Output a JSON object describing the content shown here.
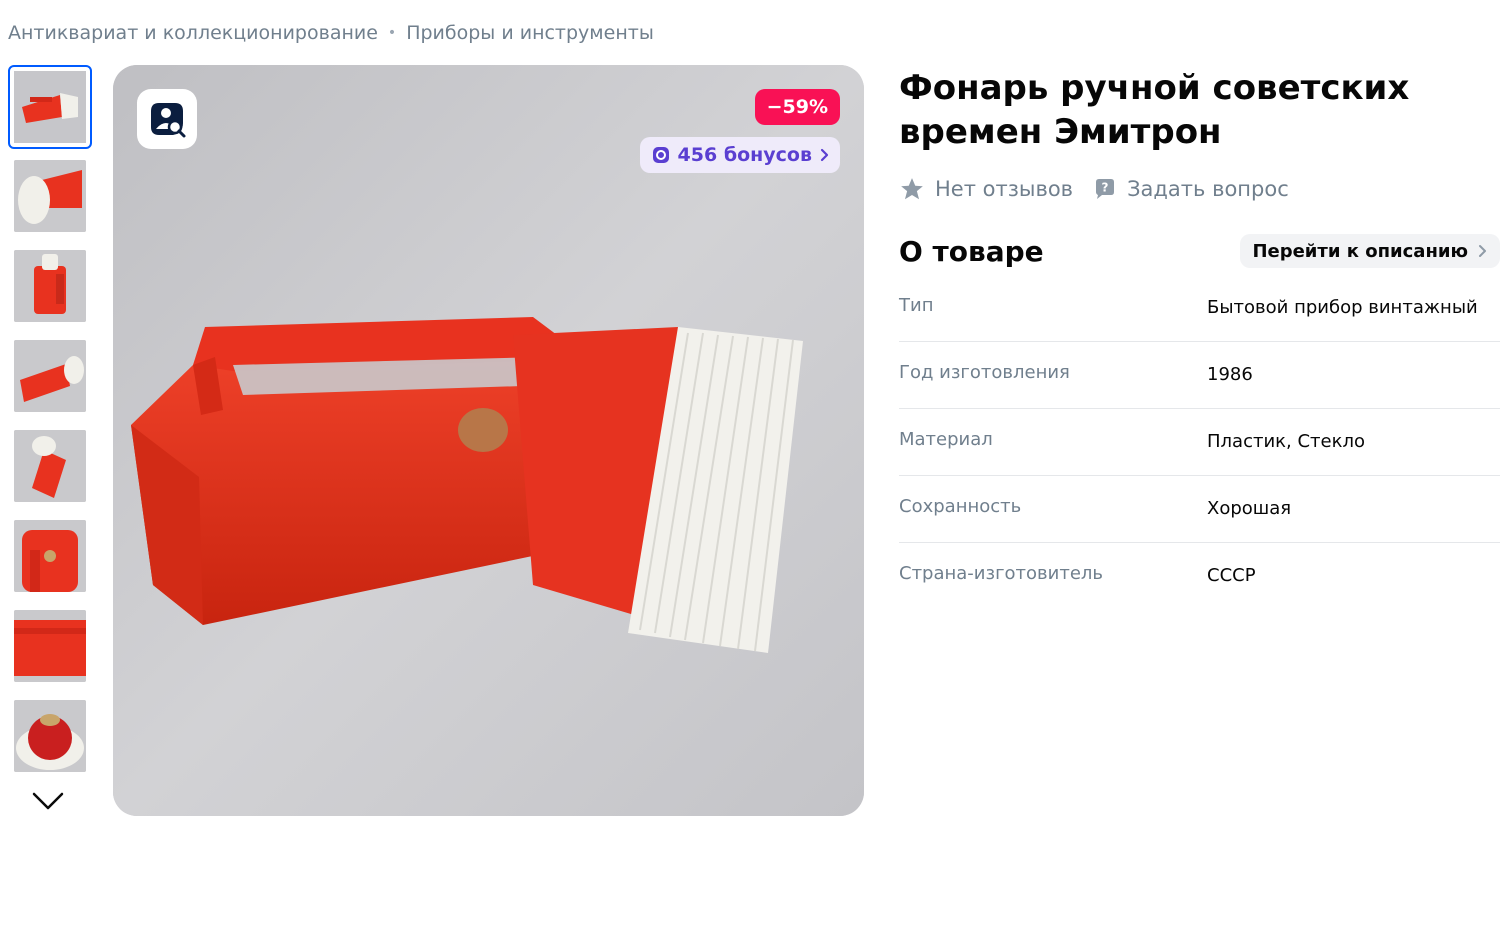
{
  "breadcrumbs": [
    "Антиквариат и коллекционирование",
    "Приборы и инструменты"
  ],
  "breadcrumb_separator": "•",
  "thumbnails": {
    "count": 8,
    "active_index": 0,
    "images": [
      "flashlight-side-red-white",
      "flashlight-top-view",
      "flashlight-handle-up",
      "flashlight-angled",
      "flashlight-vertical",
      "flashlight-lamp-closeup",
      "flashlight-body-closeup",
      "flashlight-reflector-closeup"
    ],
    "scroll_icon": "chevron-down-icon"
  },
  "gallery": {
    "image": "red-soviet-flashlight-on-grey-background",
    "search_icon": "photo-search-icon",
    "discount": "−59%",
    "bonus": "456 бонусов",
    "bonus_icon": "bonus-coin-icon"
  },
  "product": {
    "title": "Фонарь ручной советских времен Эмитрон",
    "reviews": "Нет отзывов",
    "ask_question": "Задать вопрос"
  },
  "about": {
    "title": "О товаре",
    "go_to_description": "Перейти к описанию",
    "properties": [
      {
        "name": "Тип",
        "value": "Бытовой прибор винтажный"
      },
      {
        "name": "Год изготовления",
        "value": "1986"
      },
      {
        "name": "Материал",
        "value": "Пластик, Стекло"
      },
      {
        "name": "Сохранность",
        "value": "Хорошая"
      },
      {
        "name": "Страна-изготовитель",
        "value": "СССР"
      }
    ]
  },
  "colors": {
    "accent": "#005bff",
    "discount": "#f91155",
    "bonus_text": "#5a3fd1",
    "product_red": "#e8321f",
    "muted_text": "#707f8d"
  }
}
